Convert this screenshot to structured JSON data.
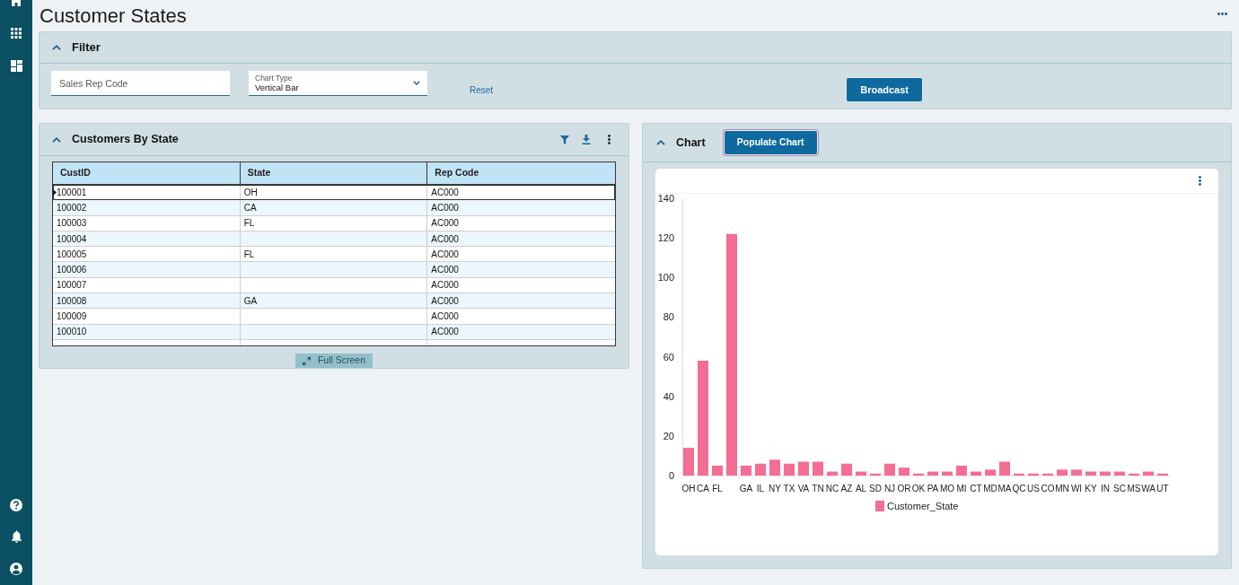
{
  "page": {
    "title": "Customer States"
  },
  "filter_panel": {
    "title": "Filter",
    "expanded": true,
    "sales_rep_code": {
      "placeholder": "Sales Rep Code"
    },
    "chart_type": {
      "label": "Chart Type",
      "value": "Vertical Bar"
    },
    "reset_link": "Reset",
    "broadcast_button": "Broadcast"
  },
  "customers_panel": {
    "title": "Customers By State",
    "expanded": true,
    "table": {
      "columns": [
        "CustID",
        "State",
        "Rep Code"
      ],
      "rows": [
        {
          "cust_id": "100001",
          "state": "OH",
          "rep_code": "AC000",
          "selected": true
        },
        {
          "cust_id": "100002",
          "state": "CA",
          "rep_code": "AC000",
          "selected": false
        },
        {
          "cust_id": "100003",
          "state": "FL",
          "rep_code": "AC000",
          "selected": false
        },
        {
          "cust_id": "100004",
          "rep_code": "AC000",
          "selected": false
        },
        {
          "cust_id": "100005",
          "state": "FL",
          "rep_code": "AC000",
          "selected": false
        },
        {
          "cust_id": "100006",
          "rep_code": "AC000",
          "selected": false
        },
        {
          "cust_id": "100007",
          "rep_code": "AC000",
          "selected": false
        },
        {
          "cust_id": "100008",
          "state": "GA",
          "rep_code": "AC000",
          "selected": false
        },
        {
          "cust_id": "100009",
          "rep_code": "AC000",
          "selected": false
        },
        {
          "cust_id": "100010",
          "rep_code": "AC000",
          "selected": false
        }
      ]
    },
    "full_screen_button": "Full Screen"
  },
  "chart_panel": {
    "title": "Chart",
    "expanded": true,
    "populate_button": {
      "label": "Populate Chart",
      "focused": true
    },
    "chart_data": {
      "type": "bar",
      "categories": [
        "OH",
        "CA",
        "FL",
        null,
        "GA",
        "IL",
        "NY",
        "TX",
        "VA",
        "TN",
        "NC",
        "AZ",
        "AL",
        "SD",
        "NJ",
        "OR",
        "OK",
        "PA",
        "MO",
        "MI",
        "CT",
        "MD",
        "MA",
        "QC",
        "US",
        "CO",
        "MN",
        "WI",
        "KY",
        "IN",
        "SC",
        "MS",
        "WA",
        "UT"
      ],
      "series": [
        {
          "name": "Customer_State",
          "color": "#f46d94",
          "values": [
            14,
            58,
            5,
            122,
            5,
            6,
            8,
            6,
            7,
            7,
            2,
            6,
            2,
            1,
            6,
            4,
            1,
            2,
            2,
            5,
            2,
            3,
            7,
            1,
            1,
            1,
            3,
            3,
            2,
            2,
            2,
            1,
            2,
            1
          ]
        }
      ],
      "ylim": [
        0,
        140
      ],
      "yticks": [
        0,
        20,
        40,
        60,
        80,
        100,
        120,
        140
      ]
    }
  }
}
